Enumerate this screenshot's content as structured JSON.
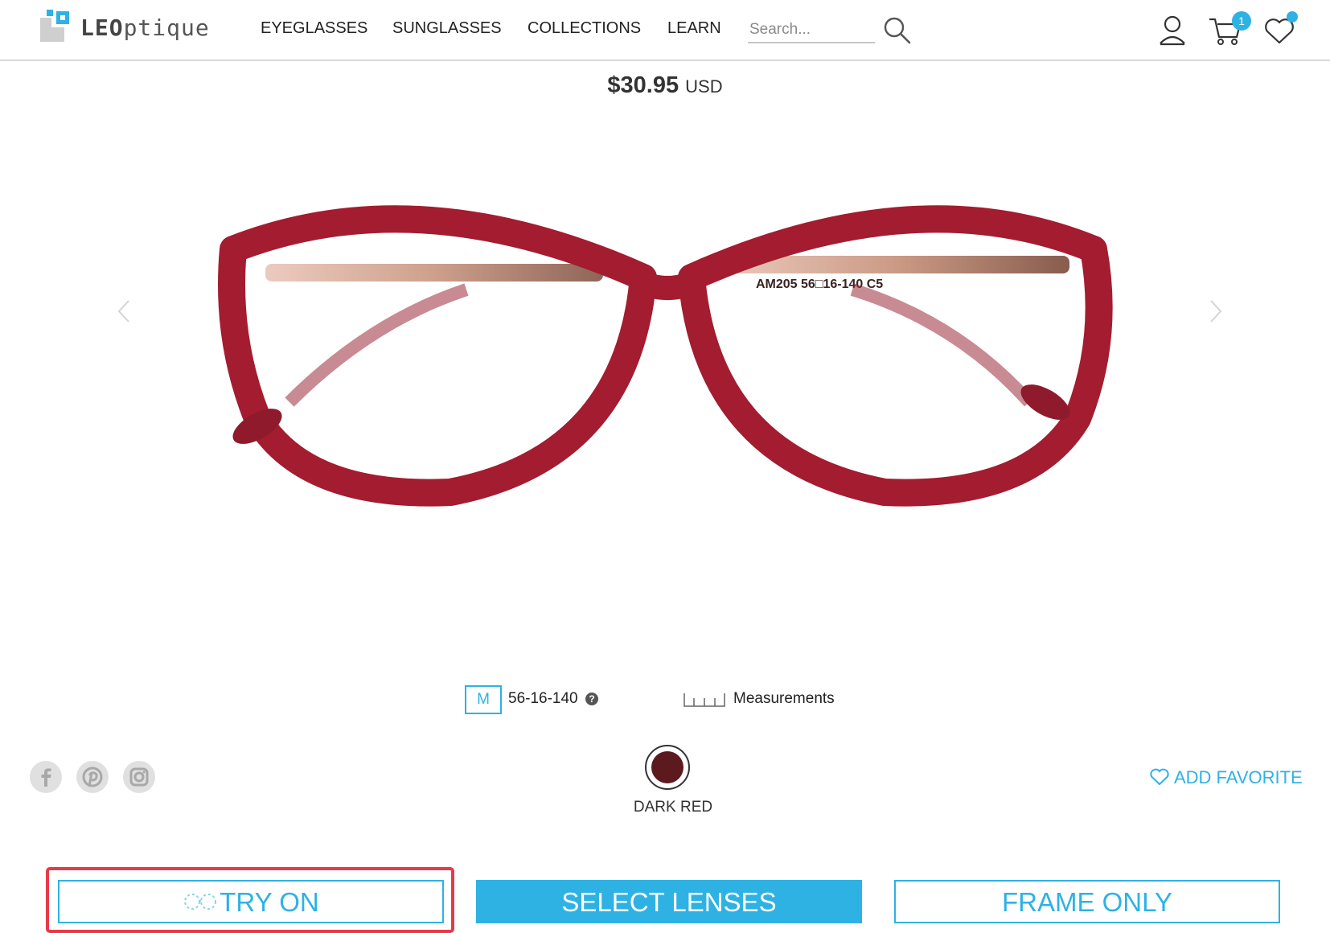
{
  "brand": {
    "name": "LEOptique",
    "name_part1": "LEO",
    "name_part2": "ptique"
  },
  "nav": {
    "items": [
      "EYEGLASSES",
      "SUNGLASSES",
      "COLLECTIONS",
      "LEARN"
    ]
  },
  "search": {
    "placeholder": "Search..."
  },
  "header_icons": {
    "account": "user-icon",
    "cart": "cart-icon",
    "cart_count": "1",
    "favorites": "heart-icon"
  },
  "product": {
    "price": "$30.95",
    "currency": "USD",
    "temple_print": "AM205 56□16-140 C5",
    "size": {
      "code": "M",
      "dimensions": "56-16-140",
      "help": "?"
    },
    "measurements_label": "Measurements",
    "color": {
      "name": "DARK RED",
      "hex": "#5c1a1f"
    },
    "frame_color": "#a01b2e"
  },
  "social": [
    "facebook-icon",
    "pinterest-icon",
    "instagram-icon"
  ],
  "favorite": {
    "label": "ADD FAVORITE"
  },
  "actions": {
    "try_on": "TRY ON",
    "select_lenses": "SELECT LENSES",
    "frame_only": "FRAME ONLY"
  },
  "colors": {
    "accent": "#2eb2e4",
    "highlight": "#e8394a"
  }
}
